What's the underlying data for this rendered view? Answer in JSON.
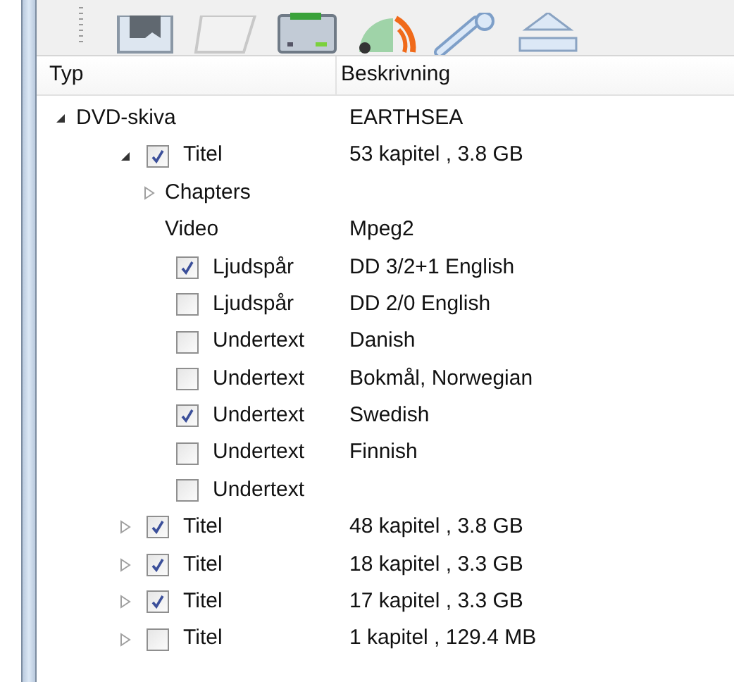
{
  "columns": [
    "Typ",
    "Beskrivning"
  ],
  "tree": [
    {
      "kind": "plain",
      "label": "DVD-skiva",
      "description": "EARTHSEA",
      "expanded": true,
      "children": [
        {
          "kind": "checkable",
          "label": "Titel",
          "description": "53 kapitel , 3.8 GB",
          "checked": true,
          "expanded": true,
          "children": [
            {
              "kind": "plain",
              "label": "Chapters",
              "expanded": false
            },
            {
              "kind": "plain",
              "label": "Video",
              "description": "Mpeg2"
            },
            {
              "kind": "checkable",
              "label": "Ljudspår",
              "description": "DD 3/2+1 English",
              "checked": true
            },
            {
              "kind": "checkable",
              "label": "Ljudspår",
              "description": "DD 2/0 English",
              "checked": false
            },
            {
              "kind": "checkable",
              "label": "Undertext",
              "description": "Danish",
              "checked": false
            },
            {
              "kind": "checkable",
              "label": "Undertext",
              "description": "Bokmål, Norwegian",
              "checked": false
            },
            {
              "kind": "checkable",
              "label": "Undertext",
              "description": "Swedish",
              "checked": true
            },
            {
              "kind": "checkable",
              "label": "Undertext",
              "description": "Finnish",
              "checked": false
            },
            {
              "kind": "checkable",
              "label": "Undertext",
              "checked": false
            }
          ]
        },
        {
          "kind": "checkable",
          "label": "Titel",
          "description": "48 kapitel , 3.8 GB",
          "checked": true,
          "expanded": false
        },
        {
          "kind": "checkable",
          "label": "Titel",
          "description": "18 kapitel , 3.3 GB",
          "checked": true,
          "expanded": false
        },
        {
          "kind": "checkable",
          "label": "Titel",
          "description": "17 kapitel , 3.3 GB",
          "checked": true,
          "expanded": false
        },
        {
          "kind": "checkable",
          "label": "Titel",
          "description": "1 kapitel , 129.4 MB",
          "checked": false,
          "expanded": false
        }
      ]
    }
  ]
}
